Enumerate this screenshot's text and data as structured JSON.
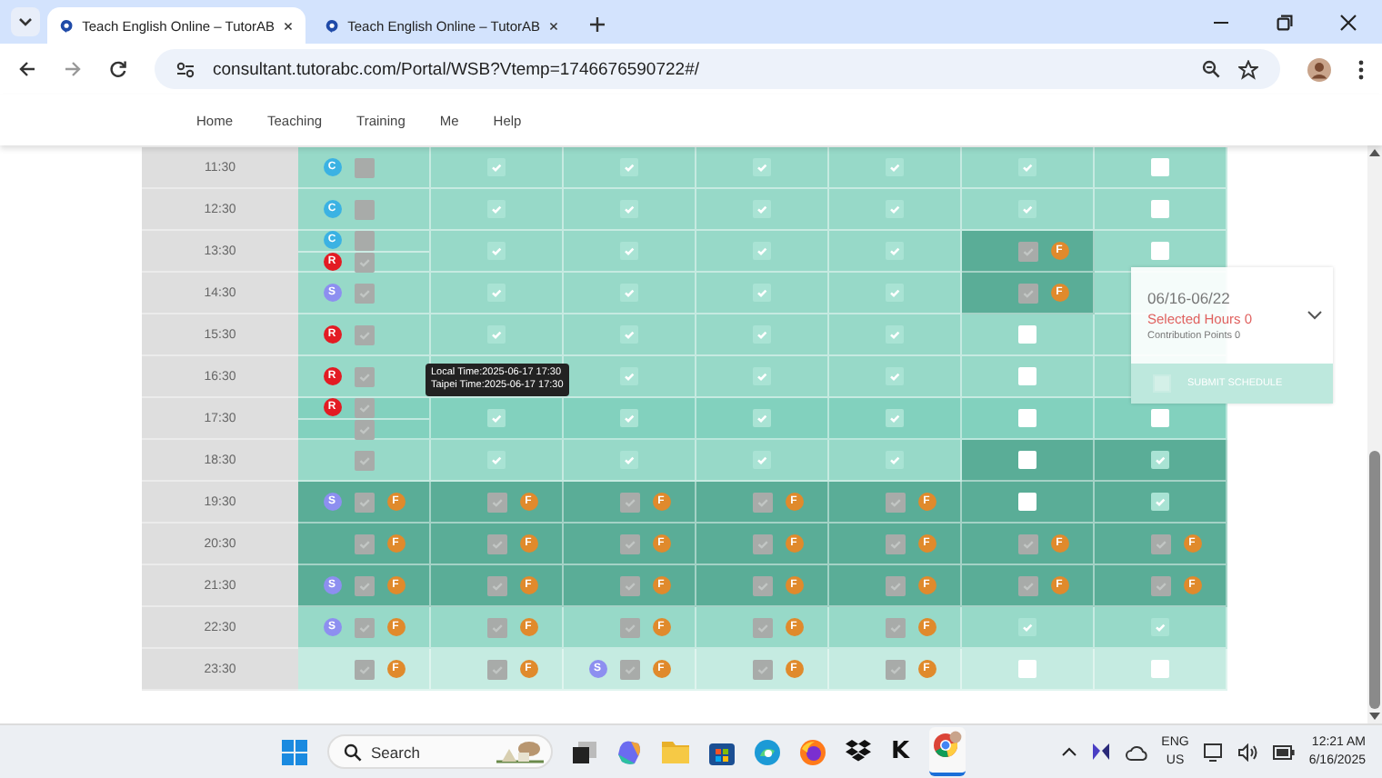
{
  "browser": {
    "tabs": [
      {
        "title": "Teach English Online – TutorAB",
        "selected": true
      },
      {
        "title": "Teach English Online – TutorAB",
        "selected": false
      }
    ],
    "url": "consultant.tutorabc.com/Portal/WSB?Vtemp=1746676590722#/"
  },
  "nav": {
    "items": [
      "Home",
      "Teaching",
      "Training",
      "Me",
      "Help"
    ]
  },
  "schedule": {
    "rows": [
      {
        "time": "11:30",
        "cells": [
          {
            "kind": "light",
            "lines": [
              [
                {
                  "kind": "badge",
                  "text": "C",
                  "color": "#3bb2e3"
                },
                {
                  "kind": "locked",
                  "checked": false
                }
              ]
            ]
          },
          {
            "kind": "light",
            "lines": [
              [
                {
                  "kind": "option",
                  "checked": true
                }
              ]
            ]
          },
          {
            "kind": "light",
            "lines": [
              [
                {
                  "kind": "option",
                  "checked": true
                }
              ]
            ]
          },
          {
            "kind": "light",
            "lines": [
              [
                {
                  "kind": "option",
                  "checked": true
                }
              ]
            ]
          },
          {
            "kind": "light",
            "lines": [
              [
                {
                  "kind": "option",
                  "checked": true
                }
              ]
            ]
          },
          {
            "kind": "light",
            "lines": [
              [
                {
                  "kind": "option",
                  "checked": true
                }
              ]
            ]
          },
          {
            "kind": "light",
            "lines": [
              [
                {
                  "kind": "option",
                  "checked": false
                }
              ]
            ]
          }
        ]
      },
      {
        "time": "12:30",
        "cells": [
          {
            "kind": "light",
            "lines": [
              [
                {
                  "kind": "badge",
                  "text": "C",
                  "color": "#3bb2e3"
                },
                {
                  "kind": "locked",
                  "checked": false
                }
              ]
            ]
          },
          {
            "kind": "light",
            "lines": [
              [
                {
                  "kind": "option",
                  "checked": true
                }
              ]
            ]
          },
          {
            "kind": "light",
            "lines": [
              [
                {
                  "kind": "option",
                  "checked": true
                }
              ]
            ]
          },
          {
            "kind": "light",
            "lines": [
              [
                {
                  "kind": "option",
                  "checked": true
                }
              ]
            ]
          },
          {
            "kind": "light",
            "lines": [
              [
                {
                  "kind": "option",
                  "checked": true
                }
              ]
            ]
          },
          {
            "kind": "light",
            "lines": [
              [
                {
                  "kind": "option",
                  "checked": true
                }
              ]
            ]
          },
          {
            "kind": "light",
            "lines": [
              [
                {
                  "kind": "option",
                  "checked": false
                }
              ]
            ]
          }
        ]
      },
      {
        "time": "13:30",
        "cells": [
          {
            "kind": "light",
            "lines": [
              [
                {
                  "kind": "badge",
                  "text": "C",
                  "color": "#3bb2e3"
                },
                {
                  "kind": "locked",
                  "checked": false
                }
              ],
              [
                {
                  "kind": "badge",
                  "text": "R",
                  "color": "#e31b23"
                },
                {
                  "kind": "locked",
                  "checked": true
                }
              ]
            ]
          },
          {
            "kind": "light",
            "lines": [
              [
                {
                  "kind": "option",
                  "checked": true
                }
              ]
            ]
          },
          {
            "kind": "light",
            "lines": [
              [
                {
                  "kind": "option",
                  "checked": true
                }
              ]
            ]
          },
          {
            "kind": "light",
            "lines": [
              [
                {
                  "kind": "option",
                  "checked": true
                }
              ]
            ]
          },
          {
            "kind": "light",
            "lines": [
              [
                {
                  "kind": "option",
                  "checked": true
                }
              ]
            ]
          },
          {
            "kind": "dark",
            "lines": [
              [
                {
                  "kind": "locked",
                  "checked": true
                },
                {
                  "kind": "badge",
                  "text": "F",
                  "color": "#e08a2c"
                }
              ]
            ]
          },
          {
            "kind": "light",
            "lines": [
              [
                {
                  "kind": "option",
                  "checked": false
                }
              ]
            ]
          }
        ]
      },
      {
        "time": "14:30",
        "cells": [
          {
            "kind": "light",
            "lines": [
              [
                {
                  "kind": "badge",
                  "text": "S",
                  "color": "#8d8ff0"
                },
                {
                  "kind": "locked",
                  "checked": true
                }
              ]
            ]
          },
          {
            "kind": "light",
            "lines": [
              [
                {
                  "kind": "option",
                  "checked": true
                }
              ]
            ]
          },
          {
            "kind": "light",
            "lines": [
              [
                {
                  "kind": "option",
                  "checked": true
                }
              ]
            ]
          },
          {
            "kind": "light",
            "lines": [
              [
                {
                  "kind": "option",
                  "checked": true
                }
              ]
            ]
          },
          {
            "kind": "light",
            "lines": [
              [
                {
                  "kind": "option",
                  "checked": true
                }
              ]
            ]
          },
          {
            "kind": "dark",
            "lines": [
              [
                {
                  "kind": "locked",
                  "checked": true
                },
                {
                  "kind": "badge",
                  "text": "F",
                  "color": "#e08a2c"
                }
              ]
            ]
          },
          {
            "kind": "light"
          }
        ]
      },
      {
        "time": "15:30",
        "cells": [
          {
            "kind": "light",
            "lines": [
              [
                {
                  "kind": "badge",
                  "text": "R",
                  "color": "#e31b23"
                },
                {
                  "kind": "locked",
                  "checked": true
                }
              ]
            ]
          },
          {
            "kind": "light",
            "lines": [
              [
                {
                  "kind": "option",
                  "checked": true
                }
              ]
            ]
          },
          {
            "kind": "light",
            "lines": [
              [
                {
                  "kind": "option",
                  "checked": true
                }
              ]
            ]
          },
          {
            "kind": "light",
            "lines": [
              [
                {
                  "kind": "option",
                  "checked": true
                }
              ]
            ]
          },
          {
            "kind": "light",
            "lines": [
              [
                {
                  "kind": "option",
                  "checked": true
                }
              ]
            ]
          },
          {
            "kind": "light",
            "lines": [
              [
                {
                  "kind": "option",
                  "checked": false
                }
              ]
            ]
          },
          {
            "kind": "light"
          }
        ]
      },
      {
        "time": "16:30",
        "cells": [
          {
            "kind": "light",
            "lines": [
              [
                {
                  "kind": "badge",
                  "text": "R",
                  "color": "#e31b23"
                },
                {
                  "kind": "locked",
                  "checked": true
                }
              ]
            ]
          },
          {
            "kind": "light"
          },
          {
            "kind": "light",
            "lines": [
              [
                {
                  "kind": "option",
                  "checked": true
                }
              ]
            ]
          },
          {
            "kind": "light",
            "lines": [
              [
                {
                  "kind": "option",
                  "checked": true
                }
              ]
            ]
          },
          {
            "kind": "light",
            "lines": [
              [
                {
                  "kind": "option",
                  "checked": true
                }
              ]
            ]
          },
          {
            "kind": "light",
            "lines": [
              [
                {
                  "kind": "option",
                  "checked": false
                }
              ]
            ]
          },
          {
            "kind": "light"
          }
        ]
      },
      {
        "time": "17:30",
        "cells": [
          {
            "kind": "medium",
            "lines": [
              [
                {
                  "kind": "badge",
                  "text": "R",
                  "color": "#e31b23"
                },
                {
                  "kind": "locked",
                  "checked": true
                }
              ],
              [
                {
                  "kind": "locked",
                  "checked": true
                }
              ]
            ]
          },
          {
            "kind": "medium",
            "lines": [
              [
                {
                  "kind": "option",
                  "checked": true
                }
              ]
            ]
          },
          {
            "kind": "medium",
            "lines": [
              [
                {
                  "kind": "option",
                  "checked": true
                }
              ]
            ]
          },
          {
            "kind": "medium",
            "lines": [
              [
                {
                  "kind": "option",
                  "checked": true
                }
              ]
            ]
          },
          {
            "kind": "medium",
            "lines": [
              [
                {
                  "kind": "option",
                  "checked": true
                }
              ]
            ]
          },
          {
            "kind": "medium",
            "lines": [
              [
                {
                  "kind": "option",
                  "checked": false
                }
              ]
            ]
          },
          {
            "kind": "medium",
            "lines": [
              [
                {
                  "kind": "option",
                  "checked": false
                }
              ]
            ]
          }
        ]
      },
      {
        "time": "18:30",
        "cells": [
          {
            "kind": "light",
            "lines": [
              [
                {
                  "kind": "locked",
                  "checked": true
                }
              ]
            ]
          },
          {
            "kind": "light",
            "lines": [
              [
                {
                  "kind": "option",
                  "checked": true
                }
              ]
            ]
          },
          {
            "kind": "light",
            "lines": [
              [
                {
                  "kind": "option",
                  "checked": true
                }
              ]
            ]
          },
          {
            "kind": "light",
            "lines": [
              [
                {
                  "kind": "option",
                  "checked": true
                }
              ]
            ]
          },
          {
            "kind": "light",
            "lines": [
              [
                {
                  "kind": "option",
                  "checked": true
                }
              ]
            ]
          },
          {
            "kind": "dark",
            "lines": [
              [
                {
                  "kind": "option",
                  "checked": false
                }
              ]
            ]
          },
          {
            "kind": "dark",
            "lines": [
              [
                {
                  "kind": "option",
                  "checked": true
                }
              ]
            ]
          }
        ]
      },
      {
        "time": "19:30",
        "cells": [
          {
            "kind": "dark",
            "lines": [
              [
                {
                  "kind": "badge",
                  "text": "S",
                  "color": "#8d8ff0"
                },
                {
                  "kind": "locked",
                  "checked": true
                },
                {
                  "kind": "badge",
                  "text": "F",
                  "color": "#e08a2c"
                }
              ]
            ]
          },
          {
            "kind": "dark",
            "lines": [
              [
                {
                  "kind": "locked",
                  "checked": true
                },
                {
                  "kind": "badge",
                  "text": "F",
                  "color": "#e08a2c"
                }
              ]
            ]
          },
          {
            "kind": "dark",
            "lines": [
              [
                {
                  "kind": "locked",
                  "checked": true
                },
                {
                  "kind": "badge",
                  "text": "F",
                  "color": "#e08a2c"
                }
              ]
            ]
          },
          {
            "kind": "dark",
            "lines": [
              [
                {
                  "kind": "locked",
                  "checked": true
                },
                {
                  "kind": "badge",
                  "text": "F",
                  "color": "#e08a2c"
                }
              ]
            ]
          },
          {
            "kind": "dark",
            "lines": [
              [
                {
                  "kind": "locked",
                  "checked": true
                },
                {
                  "kind": "badge",
                  "text": "F",
                  "color": "#e08a2c"
                }
              ]
            ]
          },
          {
            "kind": "dark",
            "lines": [
              [
                {
                  "kind": "option",
                  "checked": false
                }
              ]
            ]
          },
          {
            "kind": "dark",
            "lines": [
              [
                {
                  "kind": "option",
                  "checked": true
                }
              ]
            ]
          }
        ]
      },
      {
        "time": "20:30",
        "cells": [
          {
            "kind": "dark",
            "lines": [
              [
                {
                  "kind": "locked",
                  "checked": true
                },
                {
                  "kind": "badge",
                  "text": "F",
                  "color": "#e08a2c"
                }
              ]
            ]
          },
          {
            "kind": "dark",
            "lines": [
              [
                {
                  "kind": "locked",
                  "checked": true
                },
                {
                  "kind": "badge",
                  "text": "F",
                  "color": "#e08a2c"
                }
              ]
            ]
          },
          {
            "kind": "dark",
            "lines": [
              [
                {
                  "kind": "locked",
                  "checked": true
                },
                {
                  "kind": "badge",
                  "text": "F",
                  "color": "#e08a2c"
                }
              ]
            ]
          },
          {
            "kind": "dark",
            "lines": [
              [
                {
                  "kind": "locked",
                  "checked": true
                },
                {
                  "kind": "badge",
                  "text": "F",
                  "color": "#e08a2c"
                }
              ]
            ]
          },
          {
            "kind": "dark",
            "lines": [
              [
                {
                  "kind": "locked",
                  "checked": true
                },
                {
                  "kind": "badge",
                  "text": "F",
                  "color": "#e08a2c"
                }
              ]
            ]
          },
          {
            "kind": "dark",
            "lines": [
              [
                {
                  "kind": "locked",
                  "checked": true
                },
                {
                  "kind": "badge",
                  "text": "F",
                  "color": "#e08a2c"
                }
              ]
            ]
          },
          {
            "kind": "dark",
            "lines": [
              [
                {
                  "kind": "locked",
                  "checked": true
                },
                {
                  "kind": "badge",
                  "text": "F",
                  "color": "#e08a2c"
                }
              ]
            ]
          }
        ]
      },
      {
        "time": "21:30",
        "cells": [
          {
            "kind": "dark",
            "lines": [
              [
                {
                  "kind": "badge",
                  "text": "S",
                  "color": "#8d8ff0"
                },
                {
                  "kind": "locked",
                  "checked": true
                },
                {
                  "kind": "badge",
                  "text": "F",
                  "color": "#e08a2c"
                }
              ]
            ]
          },
          {
            "kind": "dark",
            "lines": [
              [
                {
                  "kind": "locked",
                  "checked": true
                },
                {
                  "kind": "badge",
                  "text": "F",
                  "color": "#e08a2c"
                }
              ]
            ]
          },
          {
            "kind": "dark",
            "lines": [
              [
                {
                  "kind": "locked",
                  "checked": true
                },
                {
                  "kind": "badge",
                  "text": "F",
                  "color": "#e08a2c"
                }
              ]
            ]
          },
          {
            "kind": "dark",
            "lines": [
              [
                {
                  "kind": "locked",
                  "checked": true
                },
                {
                  "kind": "badge",
                  "text": "F",
                  "color": "#e08a2c"
                }
              ]
            ]
          },
          {
            "kind": "dark",
            "lines": [
              [
                {
                  "kind": "locked",
                  "checked": true
                },
                {
                  "kind": "badge",
                  "text": "F",
                  "color": "#e08a2c"
                }
              ]
            ]
          },
          {
            "kind": "dark",
            "lines": [
              [
                {
                  "kind": "locked",
                  "checked": true
                },
                {
                  "kind": "badge",
                  "text": "F",
                  "color": "#e08a2c"
                }
              ]
            ]
          },
          {
            "kind": "dark",
            "lines": [
              [
                {
                  "kind": "locked",
                  "checked": true
                },
                {
                  "kind": "badge",
                  "text": "F",
                  "color": "#e08a2c"
                }
              ]
            ]
          }
        ]
      },
      {
        "time": "22:30",
        "cells": [
          {
            "kind": "light",
            "lines": [
              [
                {
                  "kind": "badge",
                  "text": "S",
                  "color": "#8d8ff0"
                },
                {
                  "kind": "locked",
                  "checked": true
                },
                {
                  "kind": "badge",
                  "text": "F",
                  "color": "#e08a2c"
                }
              ]
            ]
          },
          {
            "kind": "light",
            "lines": [
              [
                {
                  "kind": "locked",
                  "checked": true
                },
                {
                  "kind": "badge",
                  "text": "F",
                  "color": "#e08a2c"
                }
              ]
            ]
          },
          {
            "kind": "light",
            "lines": [
              [
                {
                  "kind": "locked",
                  "checked": true
                },
                {
                  "kind": "badge",
                  "text": "F",
                  "color": "#e08a2c"
                }
              ]
            ]
          },
          {
            "kind": "light",
            "lines": [
              [
                {
                  "kind": "locked",
                  "checked": true
                },
                {
                  "kind": "badge",
                  "text": "F",
                  "color": "#e08a2c"
                }
              ]
            ]
          },
          {
            "kind": "light",
            "lines": [
              [
                {
                  "kind": "locked",
                  "checked": true
                },
                {
                  "kind": "badge",
                  "text": "F",
                  "color": "#e08a2c"
                }
              ]
            ]
          },
          {
            "kind": "light",
            "lines": [
              [
                {
                  "kind": "option",
                  "checked": true
                }
              ]
            ]
          },
          {
            "kind": "light",
            "lines": [
              [
                {
                  "kind": "option",
                  "checked": true
                }
              ]
            ]
          }
        ]
      },
      {
        "time": "23:30",
        "cells": [
          {
            "kind": "pale",
            "lines": [
              [
                {
                  "kind": "locked",
                  "checked": true
                },
                {
                  "kind": "badge",
                  "text": "F",
                  "color": "#e08a2c"
                }
              ]
            ]
          },
          {
            "kind": "pale",
            "lines": [
              [
                {
                  "kind": "locked",
                  "checked": true
                },
                {
                  "kind": "badge",
                  "text": "F",
                  "color": "#e08a2c"
                }
              ]
            ]
          },
          {
            "kind": "pale",
            "lines": [
              [
                {
                  "kind": "badge",
                  "text": "S",
                  "color": "#8d8ff0"
                },
                {
                  "kind": "locked",
                  "checked": true
                },
                {
                  "kind": "badge",
                  "text": "F",
                  "color": "#e08a2c"
                }
              ]
            ]
          },
          {
            "kind": "pale",
            "lines": [
              [
                {
                  "kind": "locked",
                  "checked": true
                },
                {
                  "kind": "badge",
                  "text": "F",
                  "color": "#e08a2c"
                }
              ]
            ]
          },
          {
            "kind": "pale",
            "lines": [
              [
                {
                  "kind": "locked",
                  "checked": true
                },
                {
                  "kind": "badge",
                  "text": "F",
                  "color": "#e08a2c"
                }
              ]
            ]
          },
          {
            "kind": "pale",
            "lines": [
              [
                {
                  "kind": "option",
                  "checked": false
                }
              ]
            ]
          },
          {
            "kind": "pale",
            "lines": [
              [
                {
                  "kind": "option",
                  "checked": false
                }
              ]
            ]
          }
        ]
      }
    ]
  },
  "tooltip": {
    "lines": [
      "Local Time:2025-06-17 17:30",
      "Taipei Time:2025-06-17 17:30"
    ]
  },
  "summary_panel": {
    "week": "06/16-06/22",
    "selected_hours": "Selected Hours 0",
    "contribution": "Contribution Points 0",
    "submit": {
      "label": "SUBMIT SCHEDULE",
      "checked": false
    }
  },
  "taskbar": {
    "search_placeholder": "Search",
    "app_letter": "K",
    "language": "ENG",
    "region": "US",
    "time": "12:21 AM",
    "date": "6/16/2025"
  }
}
